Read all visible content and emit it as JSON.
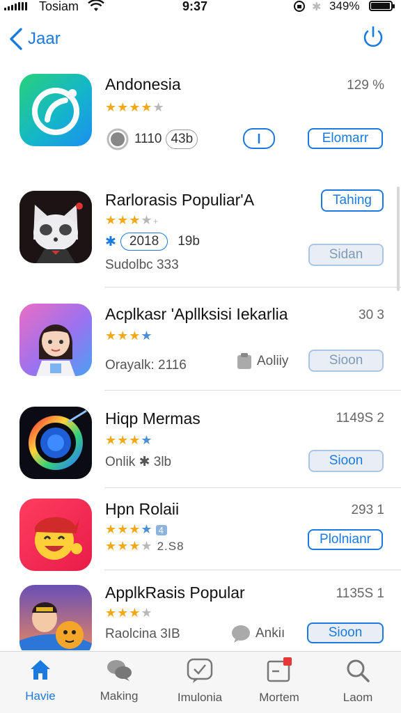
{
  "status_bar": {
    "carrier": "Tosiam",
    "time": "9:37",
    "battery_percent": "349%"
  },
  "nav": {
    "back_label": "Jaar"
  },
  "apps": [
    {
      "name": "Andonesia",
      "rank": "129 %",
      "rating": 4,
      "stat_a": "1110",
      "stat_b": "43b",
      "button": "Elomarr"
    },
    {
      "name": "Rarlorasis Populiar'A",
      "rating": 3,
      "pill": "2018",
      "stat": "19b",
      "meta": "Sudolbc 333",
      "button_top": "Tahing",
      "button": "Sidan"
    },
    {
      "name": "Acplkasr 'Apllksisi Iekarlia",
      "rank": "30 3",
      "rating": 3,
      "meta": "Orayalk: 2116",
      "chip": "Aoliiy",
      "button": "Sioon"
    },
    {
      "name": "Hiqp Mermas",
      "rank": "1149S 2",
      "rating": 3,
      "meta": "Onlik ✱ 3lb",
      "button": "Sioon"
    },
    {
      "name": "Hpn Rolaii",
      "rank": "293 1",
      "rating": 3,
      "meta": "★★★★ 2.S8",
      "button": "Plolnianr",
      "badge": "4"
    },
    {
      "name": "ApplkRasis Popular",
      "rank": "1135S 1",
      "rating": 3,
      "meta": "Raolcina 3IB",
      "chip": "Ankiı",
      "button": "Sioon"
    }
  ],
  "tabs": [
    {
      "label": "Havie",
      "icon": "home-icon"
    },
    {
      "label": "Making",
      "icon": "chat-bubbles-icon"
    },
    {
      "label": "Imulonia",
      "icon": "check-message-icon"
    },
    {
      "label": "Mortem",
      "icon": "notification-icon"
    },
    {
      "label": "Laom",
      "icon": "search-icon"
    }
  ],
  "colors": {
    "accent": "#1a7ae0",
    "star": "#f3a81a",
    "tab_bar": "#f6f6f6"
  }
}
